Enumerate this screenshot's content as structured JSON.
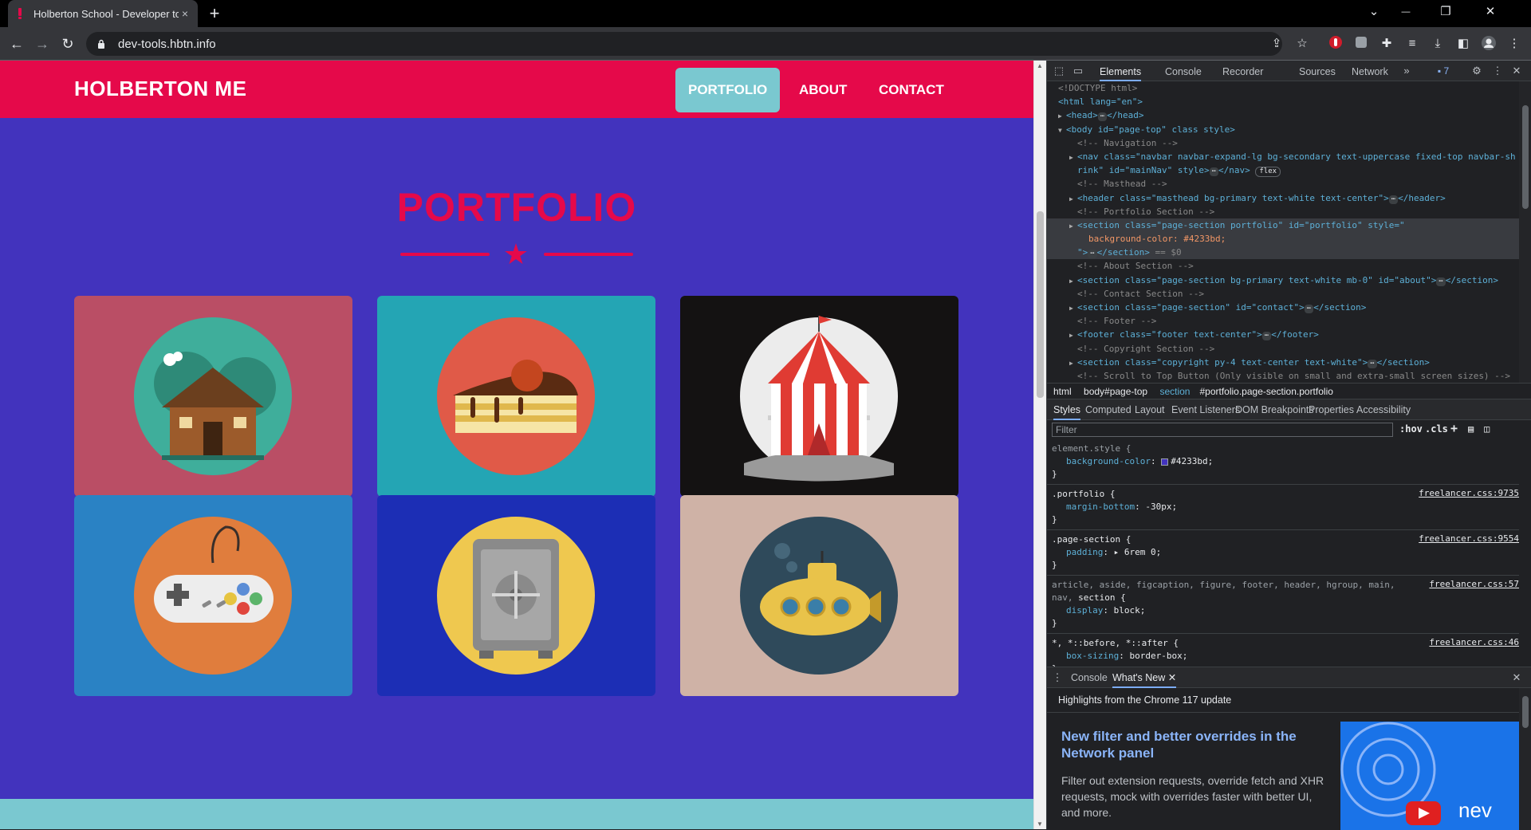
{
  "browser": {
    "tab_title": "Holberton School - Developer to",
    "tab_close": "×",
    "new_tab": "+",
    "url": "dev-tools.hbtn.info",
    "window_controls": {
      "dropdown": "⌄",
      "minimize": "—",
      "restore": "❐",
      "close": "✕"
    },
    "nav": {
      "back": "←",
      "forward": "→",
      "reload": "↻"
    }
  },
  "site": {
    "brand": "HOLBERTON ME",
    "nav_links": [
      {
        "label": "PORTFOLIO",
        "active": true
      },
      {
        "label": "ABOUT",
        "active": false
      },
      {
        "label": "CONTACT",
        "active": false
      }
    ],
    "section_title": "PORTFOLIO",
    "divider_star": "★",
    "colors": {
      "nav_bg": "#e5094a",
      "section_bg": "#4233bd",
      "accent": "#7ac8d0"
    },
    "portfolio_items": [
      {
        "icon": "cabin-icon",
        "bg": "#ba4e65"
      },
      {
        "icon": "cake-icon",
        "bg": "#24a5b4"
      },
      {
        "icon": "circus-tent-icon",
        "bg": "#141212"
      },
      {
        "icon": "game-controller-icon",
        "bg": "#2a82c4"
      },
      {
        "icon": "safe-icon",
        "bg": "#1c2eb5"
      },
      {
        "icon": "submarine-icon",
        "bg": "#cfb2a6"
      }
    ]
  },
  "devtools": {
    "tabs": [
      "Elements",
      "Console",
      "Recorder",
      "Sources",
      "Network"
    ],
    "active_tab": "Elements",
    "issues_count": "7",
    "dom": {
      "doctype": "<!DOCTYPE html>",
      "html_open": "<html lang=\"en\">",
      "head": "<head>",
      "head_close": "</head>",
      "body_open": "<body id=\"page-top\" class style>",
      "c_nav": "<!-- Navigation -->",
      "nav_line1": "<nav class=\"navbar navbar-expand-lg bg-secondary text-uppercase fixed-top navbar-sh",
      "nav_line2": "rink\" id=\"mainNav\" style>",
      "nav_close": "</nav>",
      "flex_badge": "flex",
      "c_masthead": "<!-- Masthead -->",
      "header_line": "<header class=\"masthead bg-primary text-white text-center\">",
      "header_close": "</header>",
      "c_portfolio": "<!-- Portfolio Section -->",
      "section_sel_1": "<section class=\"page-section portfolio\" id=\"portfolio\" style=\"",
      "section_sel_2": "background-color: #4233bd;",
      "section_sel_3": "\">",
      "section_sel_close": "</section>",
      "section_sel_eq": "== $0",
      "c_about": "<!-- About Section -->",
      "about_line": "<section class=\"page-section bg-primary text-white mb-0\" id=\"about\">",
      "about_close": "</section>",
      "c_contact": "<!-- Contact Section -->",
      "contact_line": "<section class=\"page-section\" id=\"contact\">",
      "contact_close": "</section>",
      "c_footer": "<!-- Footer -->",
      "footer_line": "<footer class=\"footer text-center\">",
      "footer_close": "</footer>",
      "c_copyright": "<!-- Copyright Section -->",
      "copyright_line": "<section class=\"copyright py-4 text-center text-white\">",
      "copyright_close": "</section>",
      "c_scroll": "<!-- Scroll to Top Button (Only visible on small and extra-small screen sizes) -->"
    },
    "breadcrumbs": {
      "html": "html",
      "body": "body#page-top",
      "section_tag": "section",
      "section_rest": "#portfolio.page-section.portfolio"
    },
    "sub_tabs": [
      "Styles",
      "Computed",
      "Layout",
      "Event Listeners",
      "DOM Breakpoints",
      "Properties",
      "Accessibility"
    ],
    "filter_placeholder": "Filter",
    "filter_hov": ":hov",
    "filter_cls": ".cls",
    "filter_plus": "+",
    "styles": {
      "r1_sel": "element.style {",
      "r1_prop": "background-color",
      "r1_val": "#4233bd;",
      "r2_sel": ".portfolio {",
      "r2_src": "freelancer.css:9735",
      "r2_prop": "margin-bottom",
      "r2_val": "-30px;",
      "r3_sel": ".page-section {",
      "r3_src": "freelancer.css:9554",
      "r3_prop": "padding",
      "r3_val": "6rem 0;",
      "r4_sel1": "article, aside, figcaption, figure, footer, header, hgroup, main,",
      "r4_sel2a": "nav,",
      "r4_sel2b": "section {",
      "r4_src": "freelancer.css:57",
      "r4_prop": "display",
      "r4_val": "block;",
      "r5_sel": "*, *::before, *::after {",
      "r5_src": "freelancer.css:46",
      "r5_prop": "box-sizing",
      "r5_val": "border-box;",
      "close": "}"
    },
    "drawer": {
      "tabs": [
        "Console",
        "What's New"
      ],
      "active": "What's New",
      "highlight": "Highlights from the Chrome 117 update",
      "title": "New filter and better overrides in the Network panel",
      "desc": "Filter out extension requests, override fetch and XHR requests, mock with overrides faster with better UI, and more.",
      "thumb_text": "nev"
    }
  }
}
